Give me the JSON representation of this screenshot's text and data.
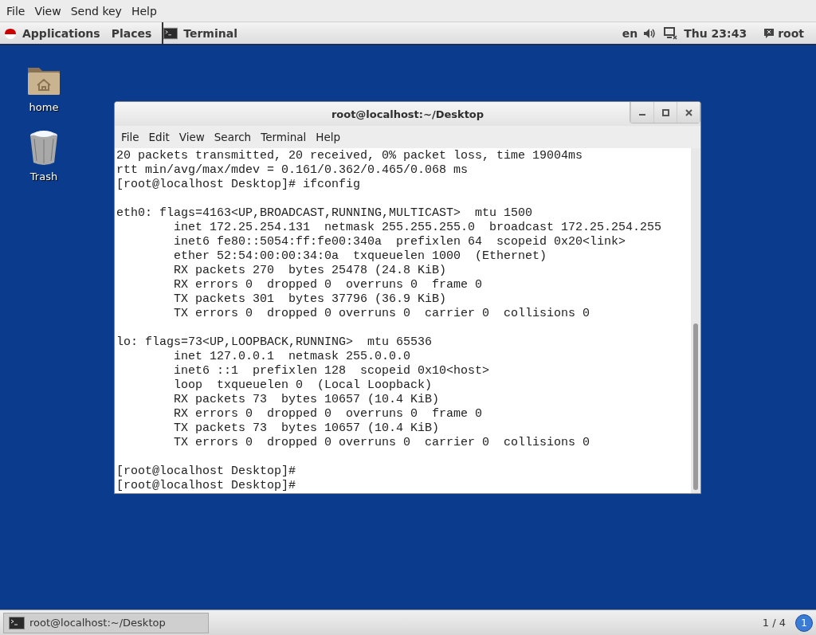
{
  "app_menu": [
    "File",
    "View",
    "Send key",
    "Help"
  ],
  "top_panel": {
    "applications": "Applications",
    "places": "Places",
    "task": "Terminal",
    "language": "en",
    "clock": "Thu 23:43",
    "user": "root"
  },
  "desktop_icons": [
    {
      "kind": "home",
      "label": "home"
    },
    {
      "kind": "trash",
      "label": "Trash"
    }
  ],
  "terminal": {
    "title": "root@localhost:~/Desktop",
    "menu": [
      "File",
      "Edit",
      "View",
      "Search",
      "Terminal",
      "Help"
    ],
    "blocks": [
      [
        "20 packets transmitted, 20 received, 0% packet loss, time 19004ms",
        "rtt min/avg/max/mdev = 0.161/0.362/0.465/0.068 ms",
        "[root@localhost Desktop]# ifconfig"
      ],
      [
        "eth0: flags=4163<UP,BROADCAST,RUNNING,MULTICAST>  mtu 1500",
        "        inet 172.25.254.131  netmask 255.255.255.0  broadcast 172.25.254.255",
        "        inet6 fe80::5054:ff:fe00:340a  prefixlen 64  scopeid 0x20<link>",
        "        ether 52:54:00:00:34:0a  txqueuelen 1000  (Ethernet)",
        "        RX packets 270  bytes 25478 (24.8 KiB)",
        "        RX errors 0  dropped 0  overruns 0  frame 0",
        "        TX packets 301  bytes 37796 (36.9 KiB)",
        "        TX errors 0  dropped 0 overruns 0  carrier 0  collisions 0"
      ],
      [
        "lo: flags=73<UP,LOOPBACK,RUNNING>  mtu 65536",
        "        inet 127.0.0.1  netmask 255.0.0.0",
        "        inet6 ::1  prefixlen 128  scopeid 0x10<host>",
        "        loop  txqueuelen 0  (Local Loopback)",
        "        RX packets 73  bytes 10657 (10.4 KiB)",
        "        RX errors 0  dropped 0  overruns 0  frame 0",
        "        TX packets 73  bytes 10657 (10.4 KiB)",
        "        TX errors 0  dropped 0 overruns 0  carrier 0  collisions 0"
      ],
      [
        "[root@localhost Desktop]#",
        "[root@localhost Desktop]#"
      ]
    ]
  },
  "taskbar": {
    "window": "root@localhost:~/Desktop",
    "workspace": "1 / 4",
    "notifications": "1"
  }
}
